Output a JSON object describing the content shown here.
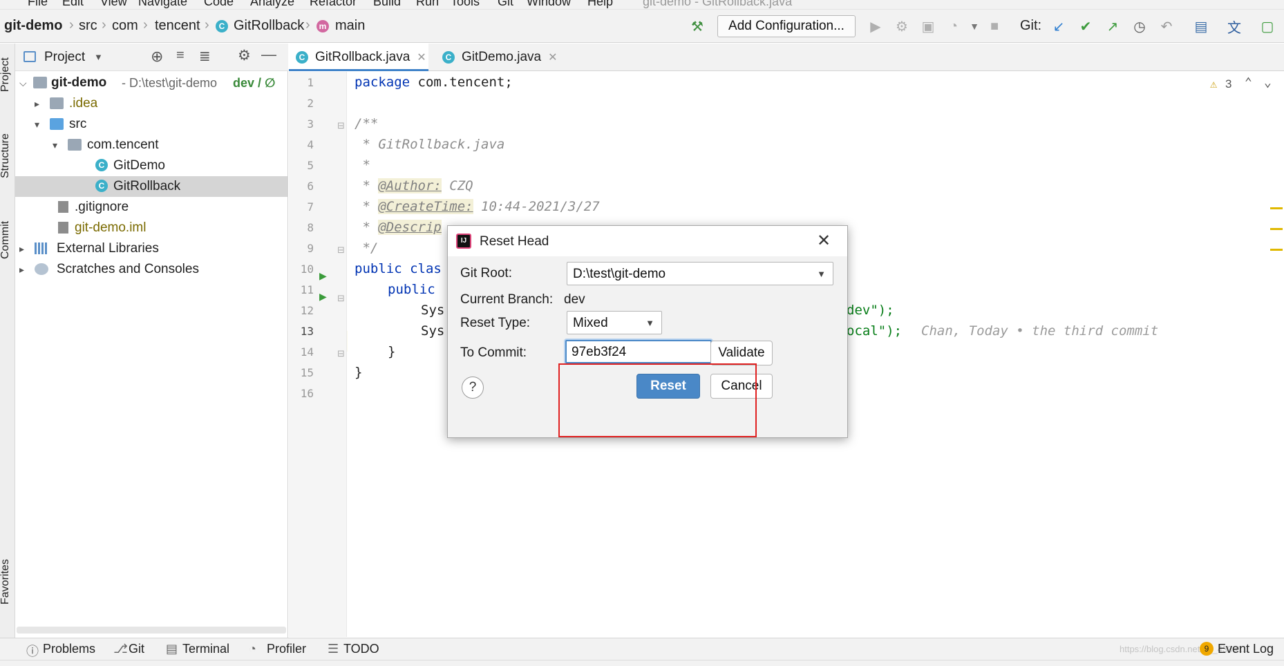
{
  "menu": {
    "items": [
      "File",
      "Edit",
      "View",
      "Navigate",
      "Code",
      "Analyze",
      "Refactor",
      "Build",
      "Run",
      "Tools",
      "Git",
      "Window",
      "Help"
    ],
    "window_title": "git-demo - GitRollback.java"
  },
  "breadcrumb": {
    "project": "git-demo",
    "parts": [
      "src",
      "com",
      "tencent",
      "GitRollback",
      "main"
    ]
  },
  "toolbar": {
    "add_configuration": "Add Configuration...",
    "git_label": "Git:"
  },
  "side_tabs": {
    "project": "Project",
    "structure": "Structure",
    "commit": "Commit",
    "favorites": "Favorites"
  },
  "project_panel": {
    "title": "Project",
    "tree": [
      {
        "label": "git-demo",
        "path": "- D:\\test\\git-demo",
        "branch": "dev / ∅"
      },
      {
        "label": ".idea"
      },
      {
        "label": "src"
      },
      {
        "label": "com.tencent"
      },
      {
        "label": "GitDemo"
      },
      {
        "label": "GitRollback"
      },
      {
        "label": ".gitignore"
      },
      {
        "label": "git-demo.iml"
      },
      {
        "label": "External Libraries"
      },
      {
        "label": "Scratches and Consoles"
      }
    ]
  },
  "editor": {
    "tabs": [
      {
        "label": "GitRollback.java"
      },
      {
        "label": "GitDemo.java"
      }
    ],
    "warnings": "3",
    "line_numbers": [
      "1",
      "2",
      "3",
      "4",
      "5",
      "6",
      "7",
      "8",
      "9",
      "10",
      "11",
      "12",
      "13",
      "14",
      "15",
      "16"
    ],
    "code": {
      "l1_kw": "package",
      "l1_rest": " com.tencent;",
      "l3": "/**",
      "l4": " * GitRollback.java",
      "l5": " *",
      "l6_pre": " * ",
      "l6_tag": "@Author:",
      "l6_val": " CZQ",
      "l7_pre": " * ",
      "l7_tag": "@CreateTime:",
      "l7_val": " 10:44-2021/3/27",
      "l8_pre": " * ",
      "l8_tag": "@Descrip",
      "l9": " */",
      "l10_kw": "public",
      "l10_rest": " clas",
      "l11_kw": "public",
      "l12": "Sys",
      "l12_tail": "dev\");",
      "l13": "Sys",
      "l13_tail": "ocal\");",
      "l13_inlay": "Chan, Today • the third commit",
      "l14": "}",
      "l15": "}"
    }
  },
  "dialog": {
    "title": "Reset Head",
    "git_root_label": "Git Root:",
    "git_root_value": "D:\\test\\git-demo",
    "current_branch_label": "Current Branch:",
    "current_branch_value": "dev",
    "reset_type_label": "Reset Type:",
    "reset_type_value": "Mixed",
    "to_commit_label": "To Commit:",
    "to_commit_value": "97eb3f24",
    "validate": "Validate",
    "reset": "Reset",
    "cancel": "Cancel",
    "help": "?"
  },
  "bottom_tools": {
    "problems": "Problems",
    "git": "Git",
    "terminal": "Terminal",
    "profiler": "Profiler",
    "todo": "TODO",
    "event_log": "Event Log",
    "event_count": "9",
    "watermark": "https://blog.csdn.net/qq_43391..."
  },
  "colors": {
    "accent": "#4083c9",
    "primary_button": "#4a88c7",
    "highlight_box": "#e02020",
    "selection": "#d5d5d5"
  }
}
